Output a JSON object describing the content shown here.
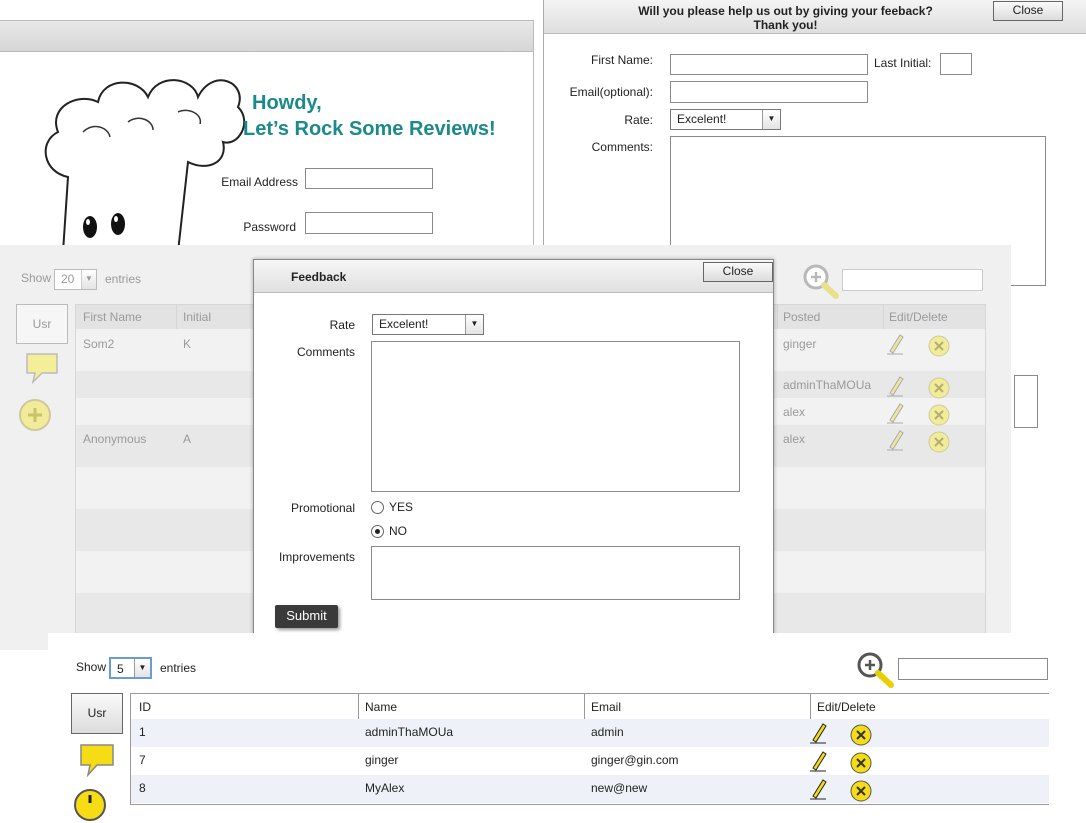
{
  "login": {
    "greeting_line1": "Howdy,",
    "greeting_line2": "Let’s Rock Some Reviews!",
    "email_label": "Email Address",
    "password_label": "Password"
  },
  "feedback_form_back": {
    "title_line1": "Will you please help us out by giving your feeback?",
    "title_line2": "Thank you!",
    "close_label": "Close",
    "first_name_label": "First Name:",
    "last_initial_label": "Last Initial:",
    "email_label": "Email(optional):",
    "rate_label": "Rate:",
    "rate_value": "Excelent!",
    "comments_label": "Comments:"
  },
  "reviews_table": {
    "show_label": "Show",
    "show_value": "20",
    "entries_label": "entries",
    "usr_button": "Usr",
    "columns": [
      "First Name",
      "Initial",
      "Posted",
      "Edit/Delete"
    ],
    "rows": [
      {
        "first": "Som2",
        "initial": "K",
        "posted": "ginger"
      },
      {
        "first": "",
        "initial": "",
        "posted": "adminThaMOUa"
      },
      {
        "first": "",
        "initial": "",
        "posted": "alex"
      },
      {
        "first": "Anonymous",
        "initial": "A",
        "posted": "alex"
      }
    ]
  },
  "feedback_modal": {
    "title": "Feedback",
    "close_label": "Close",
    "rate_label": "Rate",
    "rate_value": "Excelent!",
    "comments_label": "Comments",
    "promotional_label": "Promotional",
    "option_yes": "YES",
    "option_no": "NO",
    "promotional_selected": "NO",
    "improvements_label": "Improvements",
    "submit_label": "Submit"
  },
  "users_table": {
    "show_label": "Show",
    "show_value": "5",
    "entries_label": "entries",
    "usr_button": "Usr",
    "columns": [
      "ID",
      "Name",
      "Email",
      "Edit/Delete"
    ],
    "rows": [
      {
        "id": "1",
        "name": "adminThaMOUa",
        "email": "admin"
      },
      {
        "id": "7",
        "name": "ginger",
        "email": "ginger@gin.com"
      },
      {
        "id": "8",
        "name": "MyAlex",
        "email": "new@new"
      }
    ]
  },
  "colors": {
    "teal_heading": "#1a8a8a",
    "icon_yellow": "#f2e23a",
    "row_stripe": "#eef2f8",
    "submit_bg": "#3a3a3a"
  }
}
